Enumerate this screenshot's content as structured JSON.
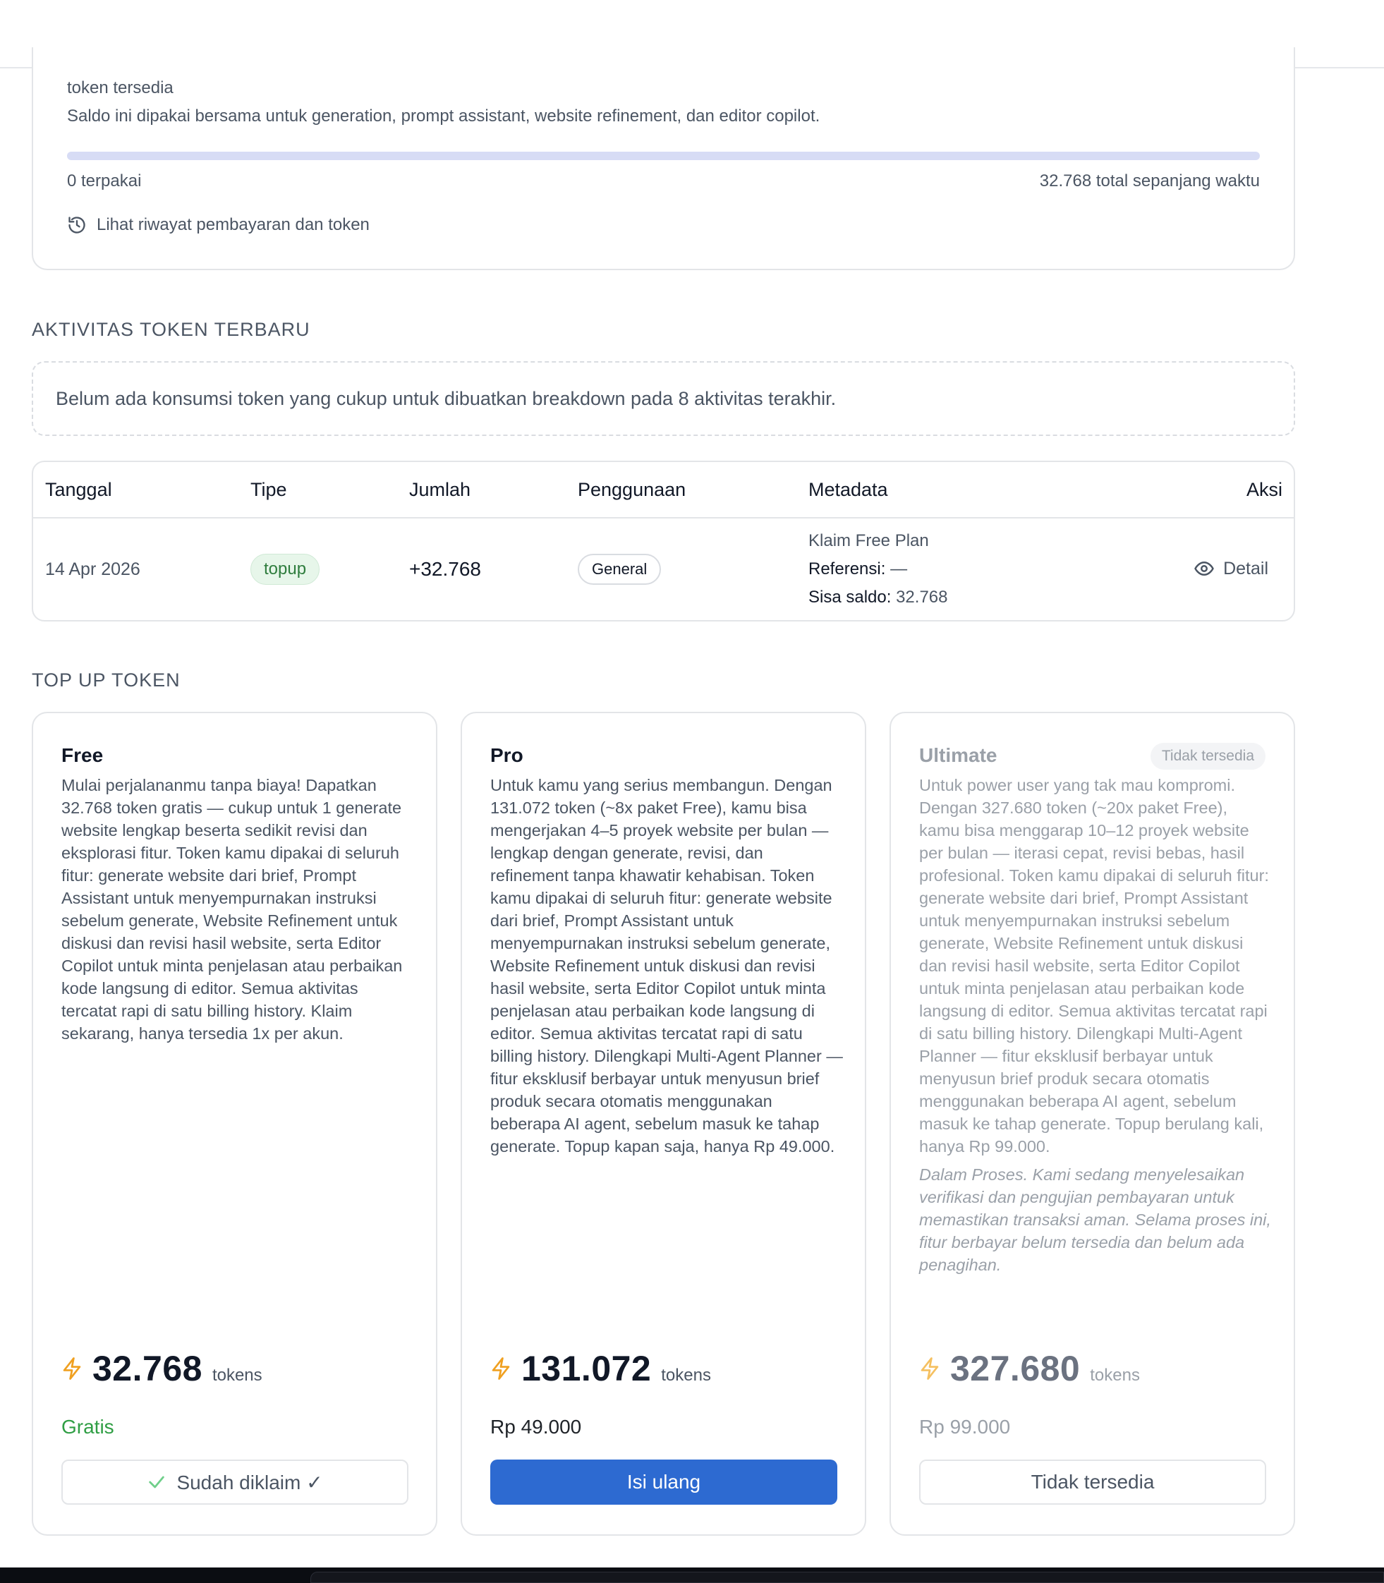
{
  "balance": {
    "label": "token tersedia",
    "description": "Saldo ini dipakai bersama untuk generation, prompt assistant, website refinement, dan editor copilot.",
    "used_fraction": 0,
    "used_text": "0 terpakai",
    "total_text": "32.768 total sepanjang waktu",
    "history_link": "Lihat riwayat pembayaran dan token",
    "accent": "#3b5bdb"
  },
  "activity": {
    "title": "AKTIVITAS TOKEN TERBARU",
    "empty_message": "Belum ada konsumsi token yang cukup untuk dibuatkan breakdown pada 8 aktivitas terakhir."
  },
  "table": {
    "headers": [
      "Tanggal",
      "Tipe",
      "Jumlah",
      "Penggunaan",
      "Metadata",
      "Aksi"
    ],
    "rows": [
      {
        "date": "14 Apr 2026",
        "type": "topup",
        "amount": "+32.768",
        "usage": "General",
        "meta_title": "Klaim Free Plan",
        "meta_ref_label": "Referensi:",
        "meta_ref_value": "—",
        "meta_balance_label": "Sisa saldo:",
        "meta_balance_value": "32.768",
        "action": "Detail"
      }
    ]
  },
  "topup": {
    "title": "TOP UP TOKEN",
    "plans": [
      {
        "name": "Free",
        "description": "Mulai perjalananmu tanpa biaya! Dapatkan 32.768 token gratis — cukup untuk 1 generate website lengkap beserta sedikit revisi dan eksplorasi fitur. Token kamu dipakai di seluruh fitur: generate website dari brief, Prompt Assistant untuk menyempurnakan instruksi sebelum generate, Website Refinement untuk diskusi dan revisi hasil website, serta Editor Copilot untuk minta penjelasan atau perbaikan kode langsung di editor. Semua aktivitas tercatat rapi di satu billing history. Klaim sekarang, hanya tersedia 1x per akun.",
        "tokens": "32.768",
        "unit": "tokens",
        "price": "Gratis",
        "price_color": "#2f9e44",
        "button": "Sudah diklaim ✓"
      },
      {
        "name": "Pro",
        "description": "Untuk kamu yang serius membangun. Dengan 131.072 token (~8x paket Free), kamu bisa mengerjakan 4–5 proyek website per bulan — lengkap dengan generate, revisi, dan refinement tanpa khawatir kehabisan. Token kamu dipakai di seluruh fitur: generate website dari brief, Prompt Assistant untuk menyempurnakan instruksi sebelum generate, Website Refinement untuk diskusi dan revisi hasil website, serta Editor Copilot untuk minta penjelasan atau perbaikan kode langsung di editor. Semua aktivitas tercatat rapi di satu billing history. Dilengkapi Multi-Agent Planner — fitur eksklusif berbayar untuk menyusun brief produk secara otomatis menggunakan beberapa AI agent, sebelum masuk ke tahap generate. Topup kapan saja, hanya Rp 49.000.",
        "tokens": "131.072",
        "unit": "tokens",
        "price": "Rp 49.000",
        "button": "Isi ulang",
        "button_color": "#2d6ad1"
      },
      {
        "name": "Ultimate",
        "badge": "Tidak tersedia",
        "description": "Untuk power user yang tak mau kompromi. Dengan 327.680 token (~20x paket Free), kamu bisa menggarap 10–12 proyek website per bulan — iterasi cepat, revisi bebas, hasil profesional. Token kamu dipakai di seluruh fitur: generate website dari brief, Prompt Assistant untuk menyempurnakan instruksi sebelum generate, Website Refinement untuk diskusi dan revisi hasil website, serta Editor Copilot untuk minta penjelasan atau perbaikan kode langsung di editor. Semua aktivitas tercatat rapi di satu billing history. Dilengkapi Multi-Agent Planner — fitur eksklusif berbayar untuk menyusun brief produk secara otomatis menggunakan beberapa AI agent, sebelum masuk ke tahap generate. Topup berulang kali, hanya Rp 99.000.",
        "note": "Dalam Proses. Kami sedang menyelesaikan verifikasi dan pengujian pembayaran untuk memastikan transaksi aman. Selama proses ini, fitur berbayar belum tersedia dan belum ada penagihan.",
        "tokens": "327.680",
        "unit": "tokens",
        "price": "Rp 99.000",
        "button": "Tidak tersedia"
      }
    ],
    "bolt_color": "#f0a020"
  }
}
